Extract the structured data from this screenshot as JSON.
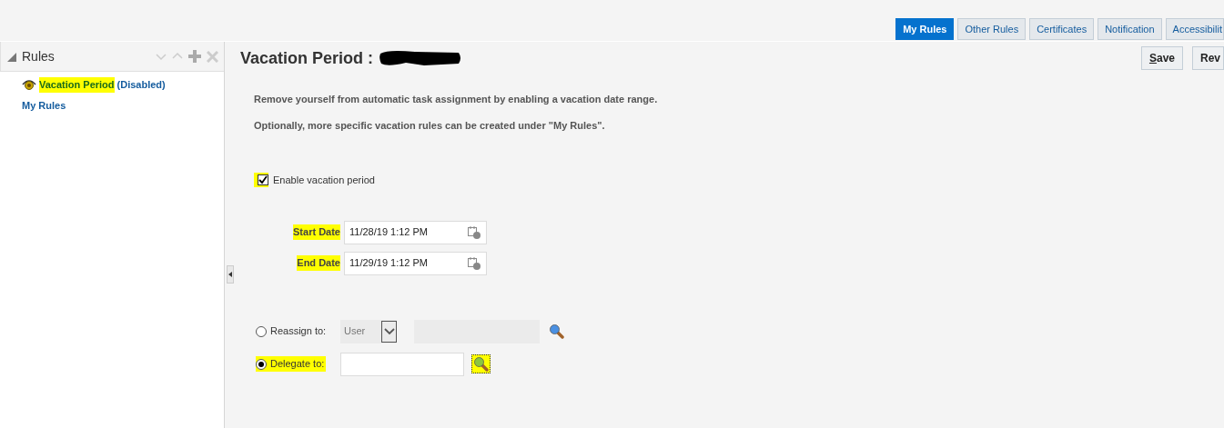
{
  "top_tabs": [
    {
      "label": "My Rules",
      "selected": true
    },
    {
      "label": "Other Rules",
      "selected": false
    },
    {
      "label": "Certificates",
      "selected": false
    },
    {
      "label": "Notification",
      "selected": false
    },
    {
      "label": "Accessibilit",
      "selected": false
    }
  ],
  "sidebar": {
    "title": "Rules",
    "items": [
      {
        "label": "Vacation Period",
        "status": "(Disabled)",
        "highlighted": true,
        "icon": true
      },
      {
        "label": "My Rules",
        "highlighted": false,
        "icon": false
      }
    ]
  },
  "page": {
    "title": "Vacation Period :",
    "redacted": true,
    "buttons": [
      {
        "label": "Save",
        "underline_first": true
      },
      {
        "label": "Rev",
        "underline_first": false
      }
    ]
  },
  "instructions": [
    "Remove yourself from automatic task assignment by enabling a vacation date range.",
    "Optionally, more specific vacation rules can be created under \"My Rules\"."
  ],
  "enable_checkbox": {
    "label": "Enable vacation period",
    "checked": true,
    "highlighted": true
  },
  "dates": [
    {
      "label": "Start Date",
      "value": "11/28/19 1:12 PM",
      "highlighted": true
    },
    {
      "label": "End Date",
      "value": "11/29/19 1:12 PM",
      "highlighted": true
    }
  ],
  "assign_options": [
    {
      "kind": "reassign",
      "label": "Reassign to:",
      "selected": false,
      "highlighted": false,
      "disabled": true,
      "type_select": "User",
      "search_highlighted": false
    },
    {
      "kind": "delegate",
      "label": "Delegate to:",
      "selected": true,
      "highlighted": true,
      "disabled": false,
      "search_highlighted": true
    }
  ]
}
